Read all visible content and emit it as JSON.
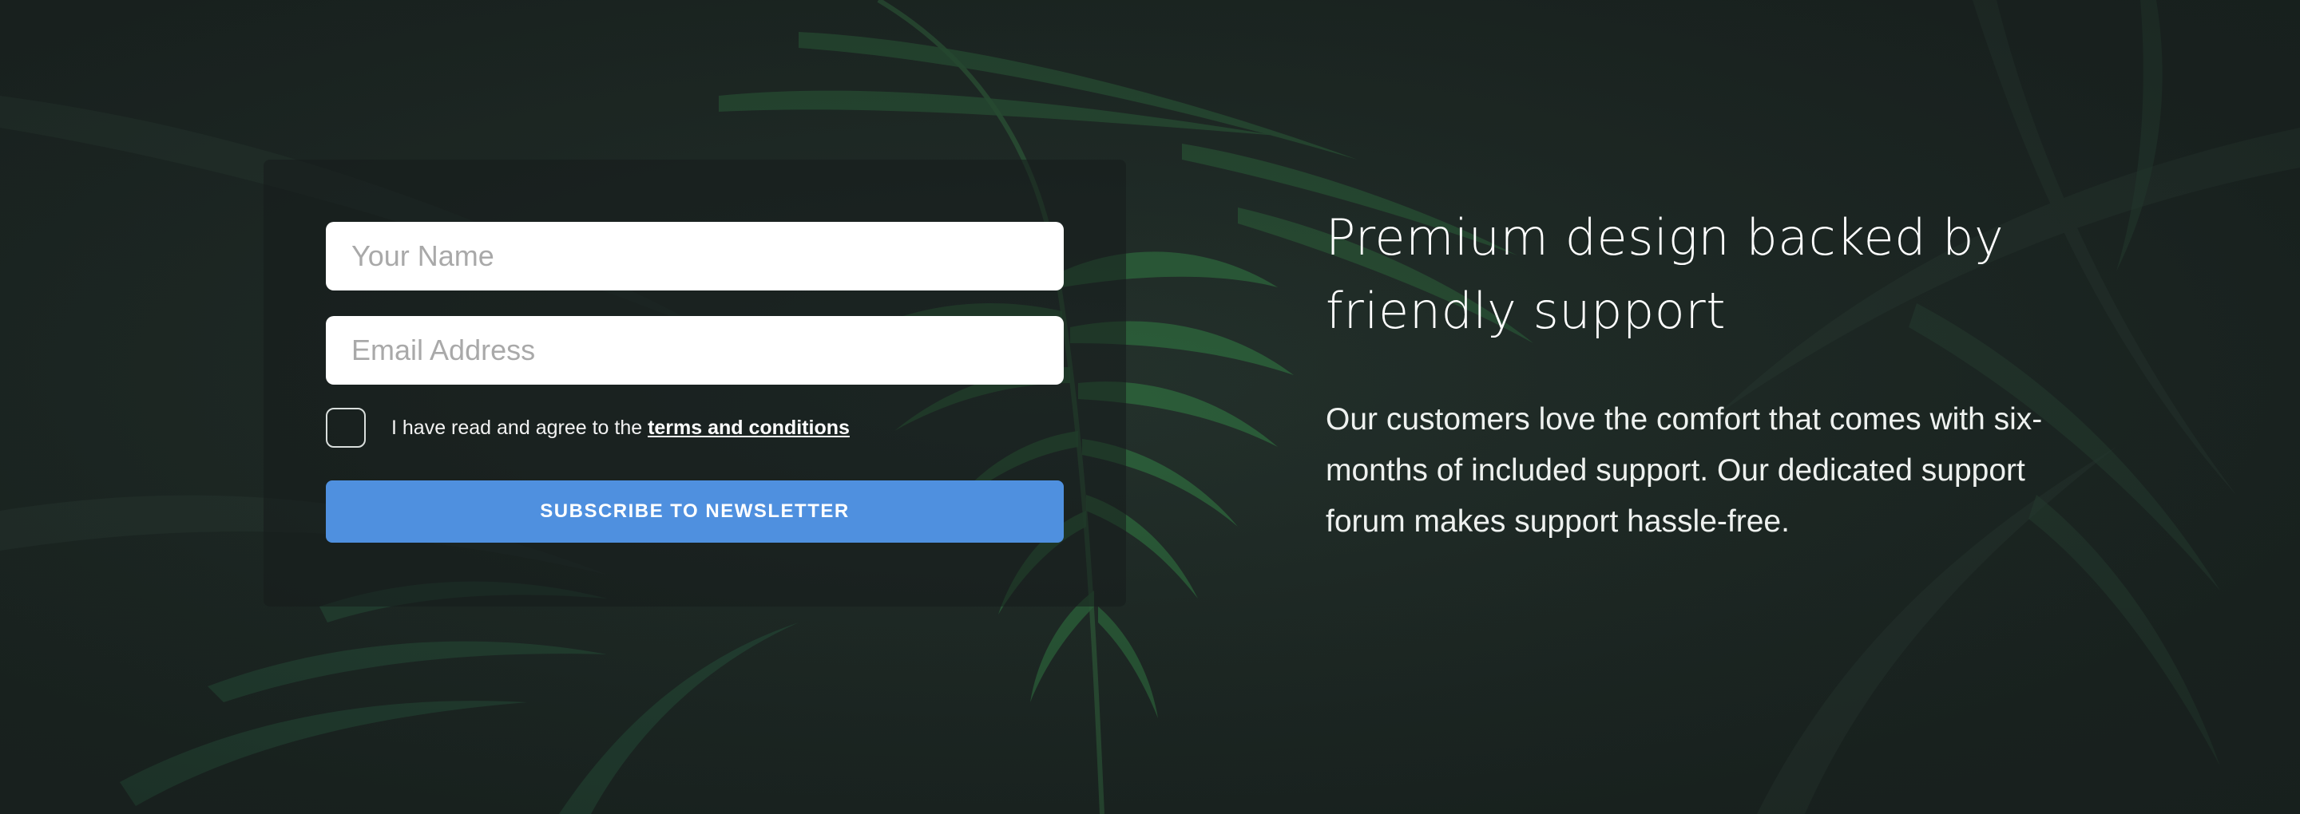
{
  "form": {
    "name_placeholder": "Your Name",
    "email_placeholder": "Email Address",
    "agree_text": "I have read and agree to the ",
    "agree_link": "terms and conditions",
    "subscribe_label": "SUBSCRIBE TO NEWSLETTER",
    "accent_color": "#4f90df",
    "checkbox_checked": false
  },
  "info": {
    "heading": "Premium design backed by friendly support",
    "body": "Our customers love the comfort that comes with six-months of included support. Our dedicated support forum makes support hassle-free."
  },
  "background": {
    "description_icon": "palm-foliage-image",
    "base_color": "#1c2623"
  }
}
